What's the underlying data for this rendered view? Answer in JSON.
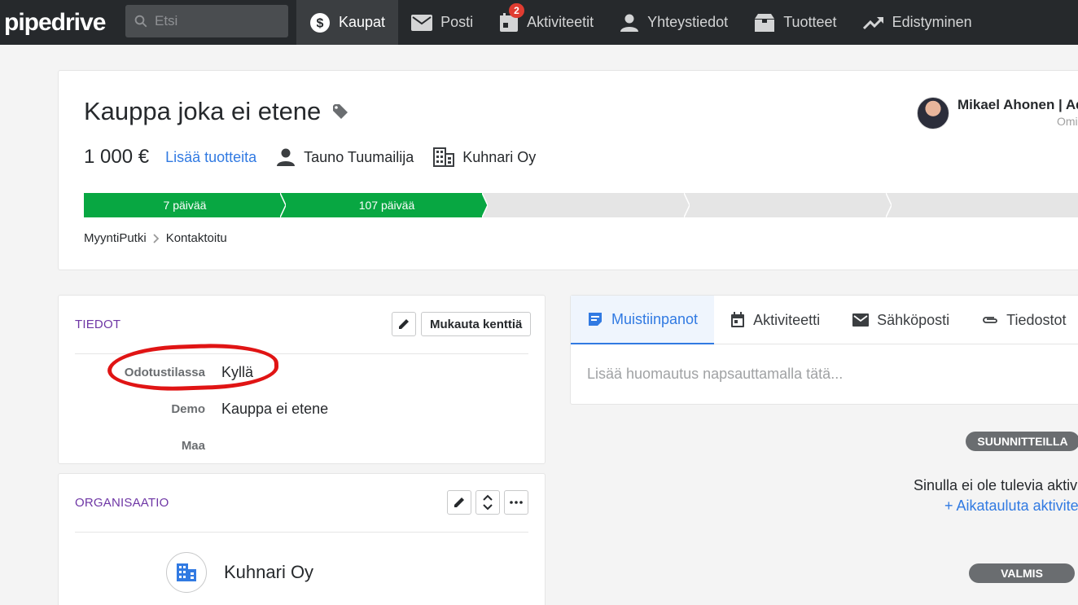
{
  "nav": {
    "logo": "pipedrive",
    "search_placeholder": "Etsi",
    "items": [
      {
        "label": "Kaupat",
        "icon": "dollar-icon",
        "active": true
      },
      {
        "label": "Posti",
        "icon": "mail-icon"
      },
      {
        "label": "Aktiviteetit",
        "icon": "calendar-icon",
        "badge": "2"
      },
      {
        "label": "Yhteystiedot",
        "icon": "person-icon"
      },
      {
        "label": "Tuotteet",
        "icon": "box-icon"
      },
      {
        "label": "Edistyminen",
        "icon": "trending-icon"
      }
    ]
  },
  "deal": {
    "title": "Kauppa joka ei etene",
    "value": "1 000 €",
    "add_products": "Lisää tuotteita",
    "person": "Tauno Tuumailija",
    "organization": "Kuhnari Oy",
    "owner_name": "Mikael Ahonen | Ad",
    "owner_role": "Omi",
    "stages": [
      "7 päivää",
      "107 päivää",
      "",
      "",
      ""
    ],
    "breadcrumb": [
      "MyyntiPutki",
      "Kontaktoitu"
    ]
  },
  "details": {
    "title": "TIEDOT",
    "customize_button": "Mukauta kenttiä",
    "fields": [
      {
        "label": "Odotustilassa",
        "value": "Kyllä"
      },
      {
        "label": "Demo",
        "value": "Kauppa ei etene"
      },
      {
        "label": "Maa",
        "value": ""
      }
    ]
  },
  "organization": {
    "title": "ORGANISAATIO",
    "name": "Kuhnari Oy"
  },
  "notes": {
    "tabs": [
      {
        "label": "Muistiinpanot",
        "icon": "note-icon",
        "active": true
      },
      {
        "label": "Aktiviteetti",
        "icon": "calendar-icon"
      },
      {
        "label": "Sähköposti",
        "icon": "mail-icon"
      },
      {
        "label": "Tiedostot",
        "icon": "paperclip-icon"
      }
    ],
    "placeholder": "Lisää huomautus napsauttamalla tätä..."
  },
  "timeline": {
    "planned_label": "SUUNNITTEILLA",
    "empty_text": "Sinulla ei ole tulevia aktivi",
    "schedule_link": "+ Aikatauluta aktivite",
    "done_label": "VALMIS"
  },
  "colors": {
    "nav_bg": "#26292c",
    "stage_done": "#08a742",
    "link": "#317ae2",
    "section_title": "#6e36a5",
    "annotation": "#e01414"
  }
}
